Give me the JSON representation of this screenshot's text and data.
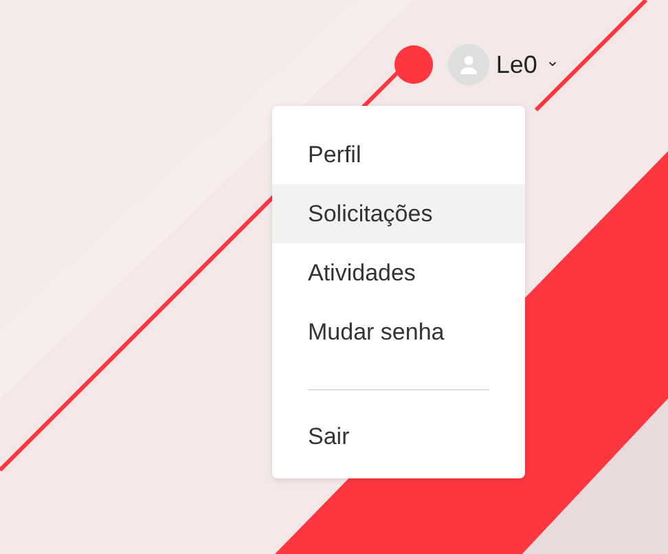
{
  "header": {
    "user_name": "Le0",
    "caret": "⌄"
  },
  "menu": {
    "items": [
      {
        "label": "Perfil",
        "selected": false
      },
      {
        "label": "Solicitações",
        "selected": true
      },
      {
        "label": "Atividades",
        "selected": false
      },
      {
        "label": "Mudar senha",
        "selected": false
      }
    ],
    "footer_items": [
      {
        "label": "Sair",
        "selected": false
      }
    ]
  }
}
